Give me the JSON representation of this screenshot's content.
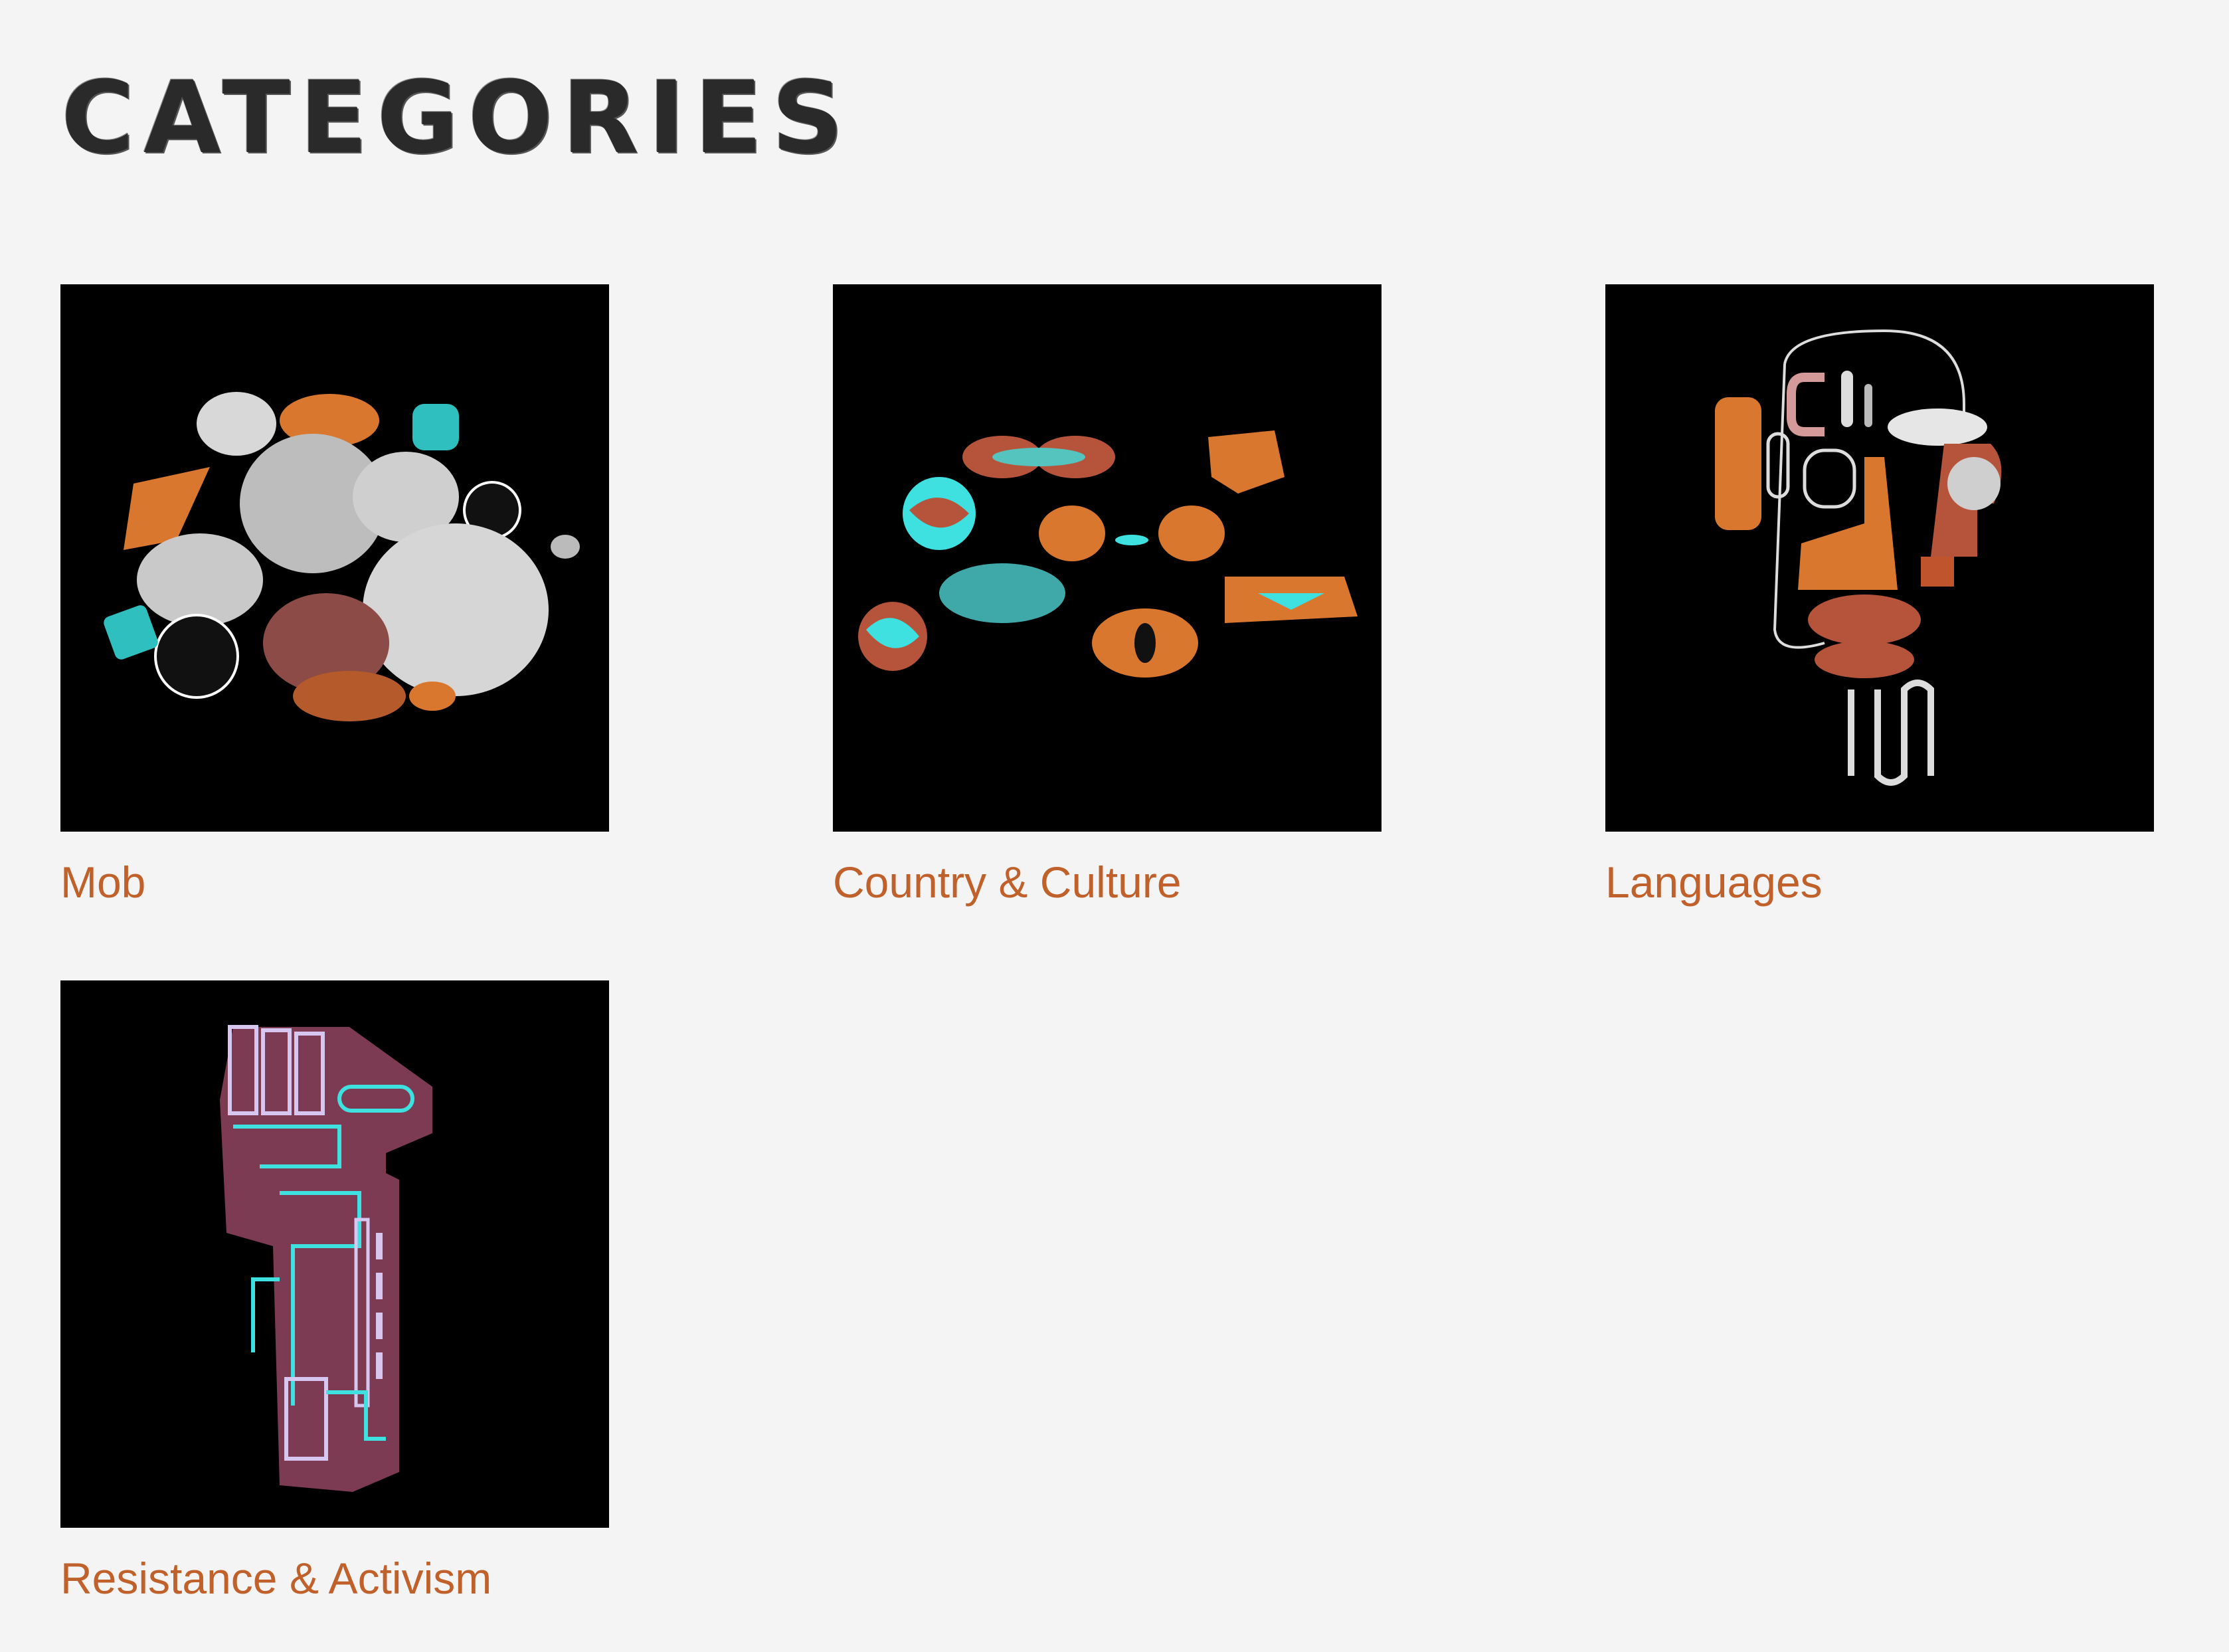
{
  "page": {
    "title": "CATEGORIES"
  },
  "categories": [
    {
      "label": "Mob",
      "image_icon": "painted-stones-icon"
    },
    {
      "label": "Country & Culture",
      "image_icon": "painted-seeds-icon"
    },
    {
      "label": "Languages",
      "image_icon": "abstract-face-icon"
    },
    {
      "label": "Resistance & Activism",
      "image_icon": "raised-fist-icon"
    }
  ],
  "colors": {
    "background": "#f4f4f4",
    "title": "#2a2a2a",
    "link": "#c0612b",
    "thumb_background": "#000000",
    "accent_orange": "#d9772e",
    "accent_cyan": "#3fe0e0",
    "accent_pink": "#a35a6e"
  }
}
